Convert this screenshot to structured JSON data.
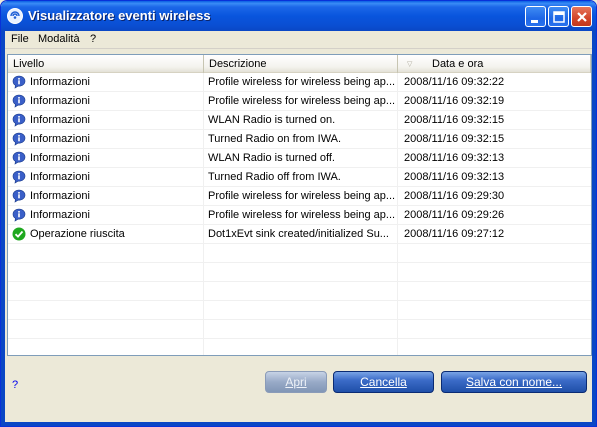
{
  "window": {
    "title": "Visualizzatore eventi wireless"
  },
  "menu": {
    "file": "File",
    "mode": "Modalità",
    "help": "?"
  },
  "columns": {
    "level": "Livello",
    "description": "Descrizione",
    "datetime": "Data e ora"
  },
  "rows": [
    {
      "icon": "info-icon",
      "level": "Informazioni",
      "description": "Profile wireless for wireless being ap...",
      "datetime": "2008/11/16 09:32:22"
    },
    {
      "icon": "info-icon",
      "level": "Informazioni",
      "description": "Profile wireless for wireless being ap...",
      "datetime": "2008/11/16 09:32:19"
    },
    {
      "icon": "info-icon",
      "level": "Informazioni",
      "description": "WLAN Radio is turned on.",
      "datetime": "2008/11/16 09:32:15"
    },
    {
      "icon": "info-icon",
      "level": "Informazioni",
      "description": "Turned Radio on from IWA.",
      "datetime": "2008/11/16 09:32:15"
    },
    {
      "icon": "info-icon",
      "level": "Informazioni",
      "description": "WLAN Radio is turned off.",
      "datetime": "2008/11/16 09:32:13"
    },
    {
      "icon": "info-icon",
      "level": "Informazioni",
      "description": "Turned Radio off from IWA.",
      "datetime": "2008/11/16 09:32:13"
    },
    {
      "icon": "info-icon",
      "level": "Informazioni",
      "description": "Profile wireless for wireless being ap...",
      "datetime": "2008/11/16 09:29:30"
    },
    {
      "icon": "info-icon",
      "level": "Informazioni",
      "description": "Profile wireless for wireless being ap...",
      "datetime": "2008/11/16 09:29:26"
    },
    {
      "icon": "success-icon",
      "level": "Operazione riuscita",
      "description": "Dot1xEvt sink created/initialized Su...",
      "datetime": "2008/11/16 09:27:12"
    }
  ],
  "footer": {
    "help": "?",
    "open": "Apri",
    "cancel": "Cancella",
    "save_as": "Salva con nome..."
  },
  "colors": {
    "titlebar": "#0a55dd",
    "info": "#3a5fc8",
    "success": "#1fa81f"
  }
}
